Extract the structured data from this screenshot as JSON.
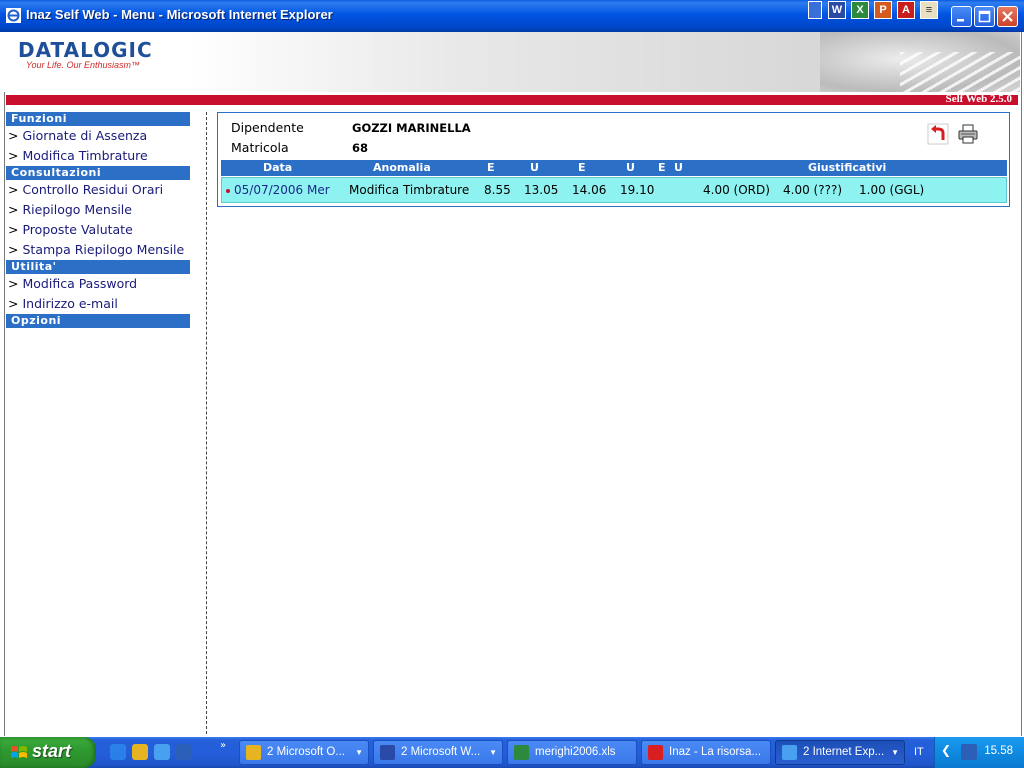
{
  "window": {
    "title": "Inaz Self Web - Menu - Microsoft Internet Explorer"
  },
  "header": {
    "brand": "DATALOGIC",
    "slogan": "Your Life. Our Enthusiasm™",
    "version": "Self Web 2.5.0"
  },
  "sidebar": {
    "arrow": ">",
    "sections": [
      {
        "title": "Funzioni",
        "items": [
          "Giornate di Assenza",
          "Modifica Timbrature"
        ]
      },
      {
        "title": "Consultazioni",
        "items": [
          "Controllo Residui Orari",
          "Riepilogo Mensile",
          "Proposte Valutate",
          "Stampa Riepilogo Mensile"
        ]
      },
      {
        "title": "Utilita'",
        "items": [
          "Modifica Password",
          "Indirizzo e-mail"
        ]
      },
      {
        "title": "Opzioni",
        "items": []
      }
    ]
  },
  "employee": {
    "name_label": "Dipendente",
    "name_value": "GOZZI MARINELLA",
    "id_label": "Matricola",
    "id_value": "68"
  },
  "grid": {
    "headers": {
      "data": "Data",
      "anomalia": "Anomalia",
      "e1": "E",
      "u1": "U",
      "e2": "E",
      "u2": "U",
      "e3": "E",
      "u3": "U",
      "giustificativi": "Giustificativi"
    },
    "row": {
      "data": "05/07/2006 Mer",
      "anomalia": "Modifica Timbrature",
      "e1": "8.55",
      "u1": "13.05",
      "e2": "14.06",
      "u2": "19.10",
      "g1": "4.00 (ORD)",
      "g2": "4.00 (???)",
      "g3": "1.00 (GGL)"
    }
  },
  "taskbar": {
    "start": "start",
    "tasks": [
      "2 Microsoft O...",
      "2 Microsoft W...",
      "merighi2006.xls",
      "Inaz - La risorsa...",
      "2 Internet Exp..."
    ],
    "language": "IT",
    "clock": "15.58"
  }
}
